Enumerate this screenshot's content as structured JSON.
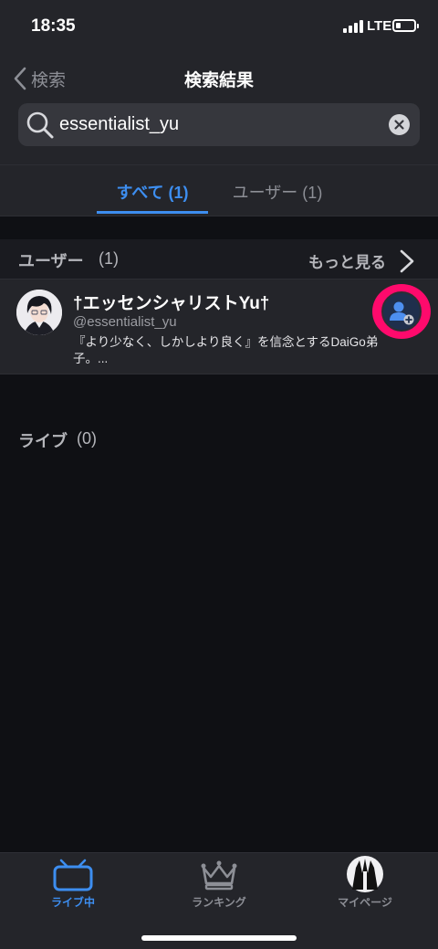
{
  "status_bar": {
    "time": "18:35",
    "network": "LTE",
    "battery_level": 0.25
  },
  "nav": {
    "back_label": "検索",
    "title": "検索結果"
  },
  "search": {
    "query": "essentialist_yu"
  },
  "tabs": [
    {
      "label": "すべて (1)",
      "selected": true
    },
    {
      "label": "ユーザー (1)",
      "selected": false
    }
  ],
  "users_section": {
    "title": "ユーザー",
    "count": "(1)",
    "more_label": "もっと見る"
  },
  "user": {
    "name": "†エッセンシャリストYu†",
    "handle": "@essentialist_yu",
    "bio": "『より少なく、しかしより良く』を信念とするDaiGo弟子。..."
  },
  "live_section": {
    "title": "ライブ",
    "count": "(0)"
  },
  "tabbar": {
    "items": [
      {
        "label": "ライブ中",
        "icon": "tv-icon",
        "active": true
      },
      {
        "label": "ランキング",
        "icon": "crown-icon",
        "active": false
      },
      {
        "label": "マイページ",
        "icon": "profile-avatar",
        "active": false
      }
    ]
  },
  "colors": {
    "accent": "#3d8ef0",
    "highlight": "#ff0a6c",
    "background": "#0f1014",
    "surface": "#24252a"
  }
}
